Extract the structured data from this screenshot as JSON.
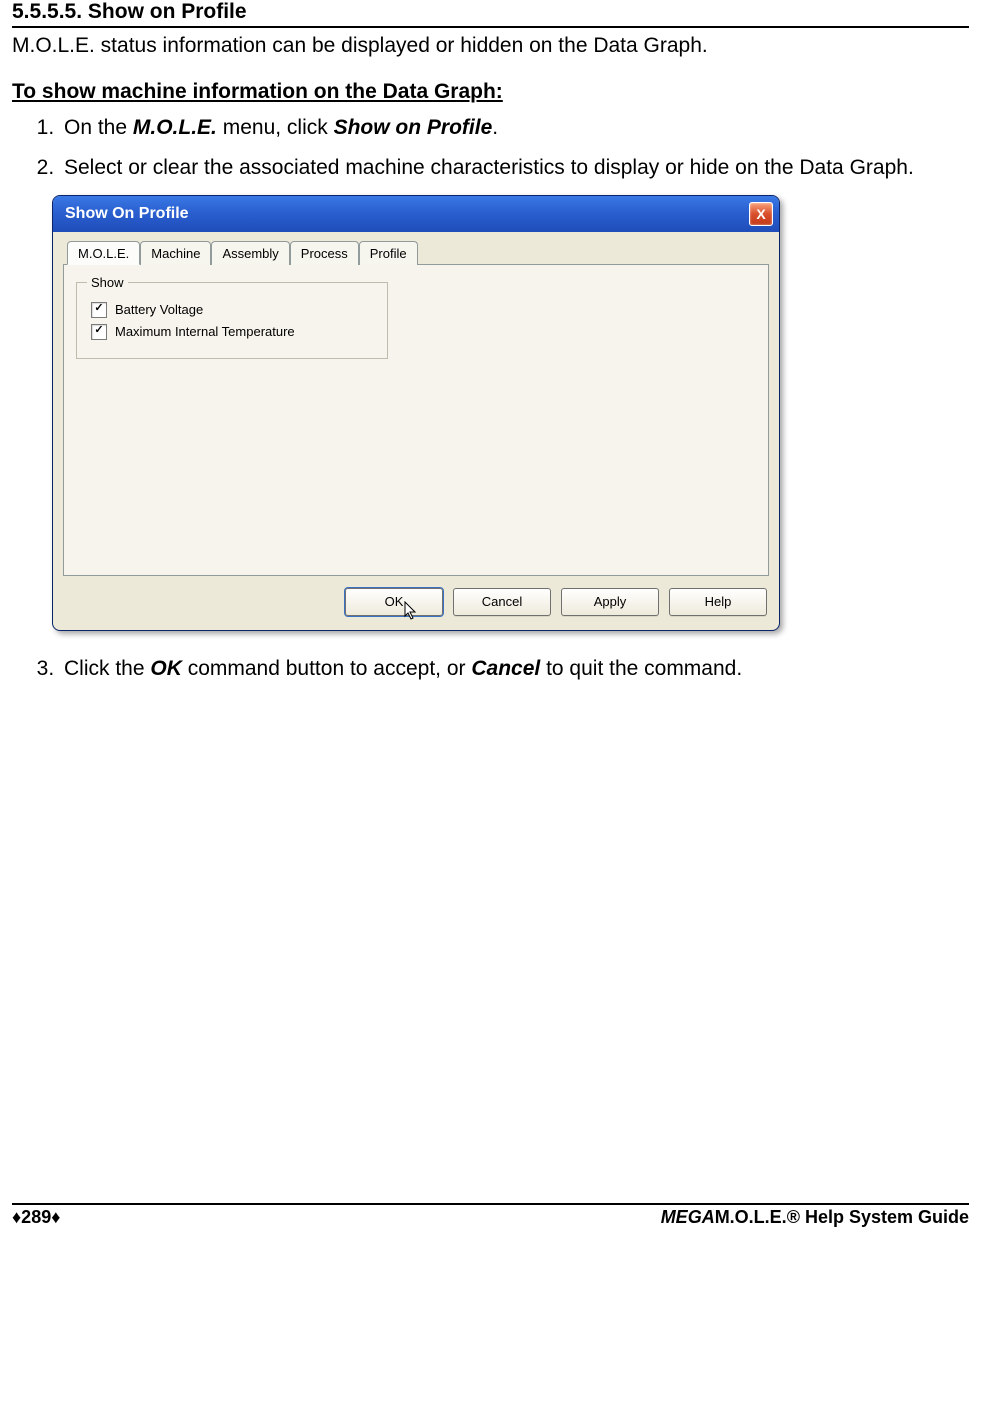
{
  "section": {
    "number": "5.5.5.5.",
    "title": "Show on Profile",
    "intro": "M.O.L.E. status information can be displayed or hidden on the Data Graph.",
    "subheading": "To show machine information on the Data Graph:"
  },
  "steps": {
    "s1_a": "On the ",
    "s1_m": "M.O.L.E.",
    "s1_b": " menu, click ",
    "s1_c": "Show on Profile",
    "s1_d": ".",
    "s2": "Select or clear the associated machine characteristics to display or hide on the Data Graph.",
    "s3_a": "Click the ",
    "s3_ok": "OK",
    "s3_b": " command button to accept, or ",
    "s3_cancel": "Cancel",
    "s3_c": " to quit the command."
  },
  "dialog": {
    "title": "Show On Profile",
    "close": "X",
    "tabs": [
      "M.O.L.E.",
      "Machine",
      "Assembly",
      "Process",
      "Profile"
    ],
    "group_legend": "Show",
    "checks": [
      {
        "label": "Battery Voltage",
        "checked": true
      },
      {
        "label": "Maximum Internal Temperature",
        "checked": true
      }
    ],
    "buttons": {
      "ok": "OK",
      "cancel": "Cancel",
      "apply": "Apply",
      "help": "Help"
    }
  },
  "footer": {
    "page": "♦289♦",
    "brand_mega": "MEGA",
    "brand_rest": "M.O.L.E.® Help System Guide"
  }
}
